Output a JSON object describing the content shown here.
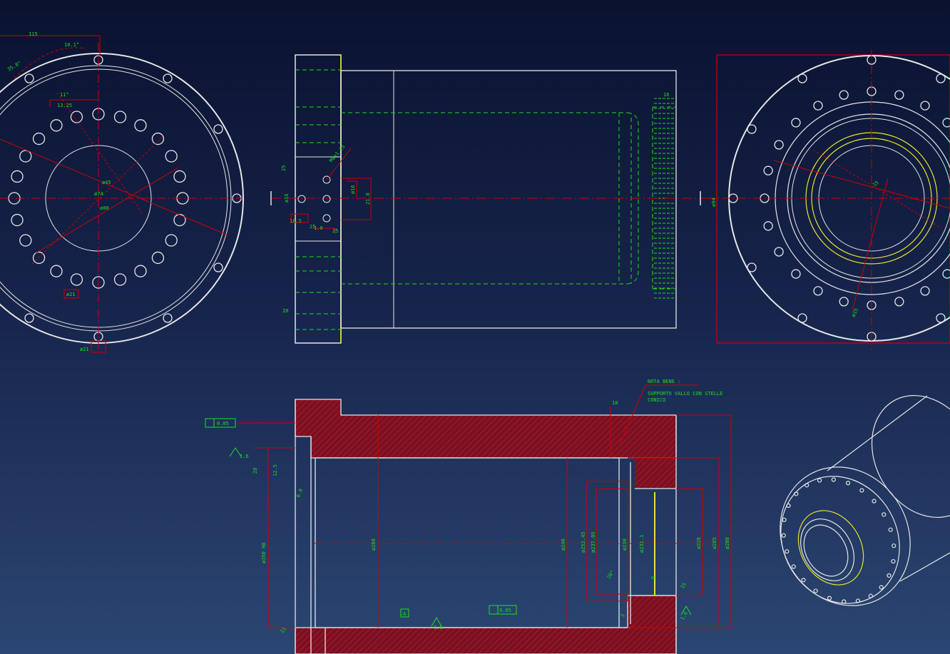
{
  "colors": {
    "background_top": "#0a1230",
    "background_bottom": "#2b4672",
    "outline": "#e6e6e6",
    "dimension": "#d00000",
    "hidden_line": "#19e019",
    "annotation_text": "#19e019",
    "section_hatch": "#7a1020",
    "highlight": "#e8e030"
  },
  "views": {
    "left_flange": {
      "dims": [
        "115",
        "10.1°",
        "35.0°",
        "13.25",
        "11°",
        "ø45",
        "ø74",
        "ø80",
        "ø21",
        "ø21"
      ]
    },
    "side": {
      "dims": [
        "16",
        "25",
        "ø16",
        "M8x1.25",
        "ø16",
        "10.5",
        "25",
        "1.0",
        "21.8",
        "20",
        "25"
      ]
    },
    "right_flange": {
      "dims": [
        "ø94",
        "15",
        "ø15"
      ]
    },
    "section": {
      "note_title": "NOTA BENE :",
      "note_line1": "SUPPORTO VALLO CON STELLE",
      "note_line2": "CONICO",
      "tolerance_frame": "0.05",
      "tolerance_frame_2": "0.05",
      "datum": "A",
      "roughness": [
        "1.6",
        "0.8",
        "1.6",
        "1.6"
      ],
      "dims": [
        "10",
        "28",
        "ø350 H8",
        "ø280",
        "ø248",
        "ø252.45",
        "ø237.05",
        "ø230",
        "ø231.1",
        "ø228",
        "ø285",
        "ø288",
        "20°",
        "15",
        "21",
        "12.5",
        "6",
        "3"
      ]
    }
  }
}
